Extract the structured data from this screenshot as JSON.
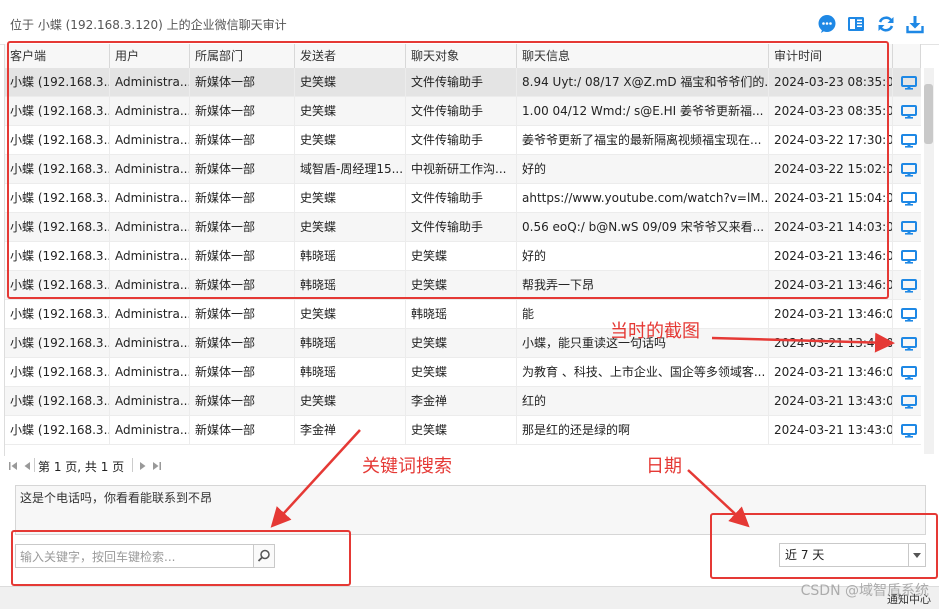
{
  "window": {
    "title": "位于 小蝶 (192.168.3.120) 上的企业微信聊天审计",
    "toolbar_icons": [
      "chat-icon",
      "book-icon",
      "refresh-icon",
      "download-icon"
    ]
  },
  "table": {
    "columns": [
      "客户端",
      "用户",
      "所属部门",
      "发送者",
      "聊天对象",
      "聊天信息",
      "审计时间"
    ],
    "rows": [
      [
        "小蝶 (192.168.3...",
        "Administra...",
        "新媒体一部",
        "史笑蝶",
        "文件传输助手",
        "8.94 Uyt:/ 08/17 X@Z.mD 福宝和爷爷们的...",
        "2024-03-23 08:35:00"
      ],
      [
        "小蝶 (192.168.3...",
        "Administra...",
        "新媒体一部",
        "史笑蝶",
        "文件传输助手",
        "1.00 04/12 Wmd:/ s@E.HI 姜爷爷更新福...",
        "2024-03-23 08:35:00"
      ],
      [
        "小蝶 (192.168.3...",
        "Administra...",
        "新媒体一部",
        "史笑蝶",
        "文件传输助手",
        "姜爷爷更新了福宝的最新隔离视频福宝现在...",
        "2024-03-22 17:30:00"
      ],
      [
        "小蝶 (192.168.3...",
        "Administra...",
        "新媒体一部",
        "域智盾-周经理15...",
        "中视新研工作沟...",
        "好的",
        "2024-03-22 15:02:00"
      ],
      [
        "小蝶 (192.168.3...",
        "Administra...",
        "新媒体一部",
        "史笑蝶",
        "文件传输助手",
        "ahttps://www.youtube.com/watch?v=lM...",
        "2024-03-21 15:04:00"
      ],
      [
        "小蝶 (192.168.3...",
        "Administra...",
        "新媒体一部",
        "史笑蝶",
        "文件传输助手",
        "0.56 eoQ:/ b@N.wS 09/09 宋爷爷又来看...",
        "2024-03-21 14:03:00"
      ],
      [
        "小蝶 (192.168.3...",
        "Administra...",
        "新媒体一部",
        "韩晓瑶",
        "史笑蝶",
        "好的",
        "2024-03-21 13:46:00"
      ],
      [
        "小蝶 (192.168.3...",
        "Administra...",
        "新媒体一部",
        "韩晓瑶",
        "史笑蝶",
        "帮我弄一下昂",
        "2024-03-21 13:46:00"
      ],
      [
        "小蝶 (192.168.3...",
        "Administra...",
        "新媒体一部",
        "史笑蝶",
        "韩晓瑶",
        "能",
        "2024-03-21 13:46:00"
      ],
      [
        "小蝶 (192.168.3...",
        "Administra...",
        "新媒体一部",
        "韩晓瑶",
        "史笑蝶",
        "小蝶，能只重读这一句话吗",
        "2024-03-21 13:46:00"
      ],
      [
        "小蝶 (192.168.3...",
        "Administra...",
        "新媒体一部",
        "韩晓瑶",
        "史笑蝶",
        "为教育 、科技、上市企业、国企等多领域客...",
        "2024-03-21 13:46:00"
      ],
      [
        "小蝶 (192.168.3...",
        "Administra...",
        "新媒体一部",
        "史笑蝶",
        "李金禅",
        "红的",
        "2024-03-21 13:43:00"
      ],
      [
        "小蝶 (192.168.3...",
        "Administra...",
        "新媒体一部",
        "李金禅",
        "史笑蝶",
        "那是红的还是绿的啊",
        "2024-03-21 13:43:00"
      ]
    ]
  },
  "pager": {
    "page_text": "第 1 页, 共 1 页"
  },
  "detail": {
    "text": "这是个电话吗，你看看能联系到不昂"
  },
  "search": {
    "placeholder": "输入关键字，按回车键检索..."
  },
  "date_filter": {
    "selected": "近 7 天"
  },
  "status_bar": {
    "text": "通知中心"
  },
  "annotations": {
    "screenshot": "当时的截图",
    "keyword_search": "关键词搜索",
    "date": "日期"
  },
  "watermark": "CSDN @域智盾系统",
  "colors": {
    "accent": "#1e88e5",
    "annotation_red": "#e53935",
    "selected_row": "#e4e4e4"
  }
}
